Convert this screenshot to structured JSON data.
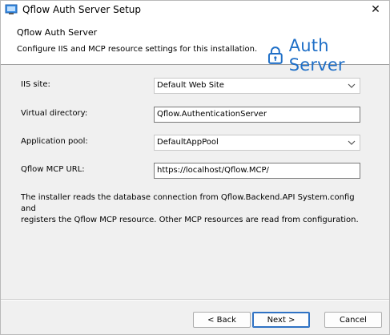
{
  "window": {
    "title": "Qflow Auth Server Setup",
    "close_glyph": "✕"
  },
  "header": {
    "title": "Qflow Auth Server",
    "subtitle": "Configure IIS and MCP resource settings for this installation.",
    "brand_text": "Auth Server",
    "brand_icon": "lock-icon",
    "brand_color": "#1f6fc7"
  },
  "form": {
    "iis_site": {
      "label": "IIS site:",
      "value": "Default Web Site"
    },
    "virtual_directory": {
      "label": "Virtual directory:",
      "value": "Qflow.AuthenticationServer"
    },
    "application_pool": {
      "label": "Application pool:",
      "value": "DefaultAppPool"
    },
    "mcp_url": {
      "label": "Qflow MCP URL:",
      "value": "https://localhost/Qflow.MCP/"
    }
  },
  "info": {
    "line1": "The installer reads the database connection from Qflow.Backend.API System.config and",
    "line2": "registers the Qflow MCP resource. Other MCP resources are read from configuration."
  },
  "buttons": {
    "back": "< Back",
    "next": "Next >",
    "cancel": "Cancel"
  }
}
